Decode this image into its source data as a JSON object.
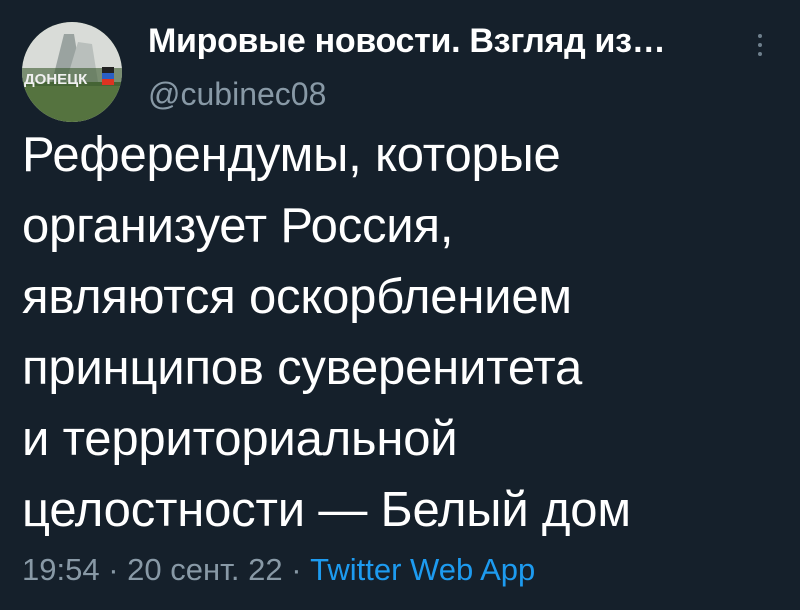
{
  "author": {
    "display_name": "Мировые новости. Взгляд из…",
    "handle": "@cubinec08",
    "avatar_text": "ДОНЕЦК"
  },
  "tweet": {
    "lines": [
      "Референдумы, которые",
      "организует Россия,",
      "являются оскорблением",
      "принципов суверенитета",
      "и территориальной",
      "целостности — Белый дом"
    ],
    "time": "19:54",
    "separator": " · ",
    "date": "20 сент. 22",
    "source": "Twitter Web App"
  },
  "colors": {
    "background": "#15202b",
    "text": "#ffffff",
    "secondary_text": "#8899a6",
    "accent": "#1d9bf0"
  },
  "icons": {
    "more": "vertical-ellipsis"
  }
}
